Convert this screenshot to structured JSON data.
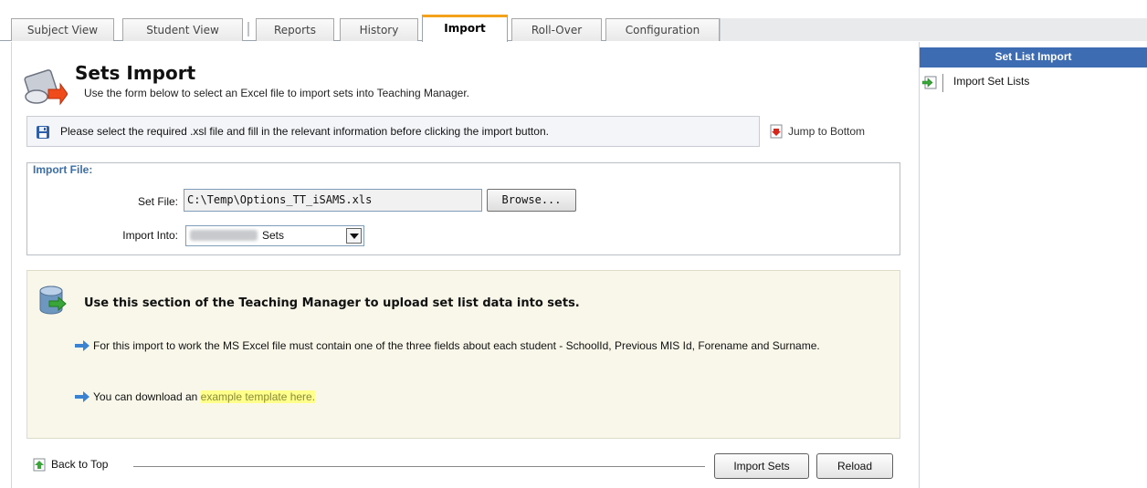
{
  "tabs": [
    {
      "label": "Subject View",
      "active": false
    },
    {
      "label": "Student View",
      "active": false
    },
    {
      "label": "Reports",
      "active": false
    },
    {
      "label": "History",
      "active": false
    },
    {
      "label": "Import",
      "active": true
    },
    {
      "label": "Roll-Over",
      "active": false
    },
    {
      "label": "Configuration",
      "active": false
    }
  ],
  "page": {
    "title": "Sets Import",
    "subtitle": "Use the form below to select an Excel file to import sets into Teaching Manager."
  },
  "notice": {
    "text": "Please select the required .xsl file and fill in the relevant information before clicking the import button.",
    "jump_label": "Jump to Bottom"
  },
  "import_file": {
    "legend": "Import File:",
    "set_file_label": "Set File:",
    "set_file_value": "C:\\Temp\\Options_TT_iSAMS.xls",
    "browse_label": "Browse...",
    "import_into_label": "Import Into:",
    "import_into_value": "Sets"
  },
  "info": {
    "title": "Use this section of the Teaching Manager to upload set list data into sets.",
    "bullet1": "For this import to work the MS Excel file must contain one of the three fields about each student - SchoolId, Previous MIS Id, Forename and Surname.",
    "bullet2_prefix": "You can download an ",
    "bullet2_link": "example template here."
  },
  "footer": {
    "back_to_top": "Back to Top",
    "import_button": "Import Sets",
    "reload_button": "Reload"
  },
  "sidebar": {
    "header": "Set List Import",
    "items": [
      {
        "label": "Import Set Lists"
      }
    ]
  },
  "colors": {
    "active_tab_accent": "#f2a21b",
    "sidebar_header_bg": "#3e6cb3",
    "legend_text": "#3c6ea6",
    "info_bg": "#f9f7ea",
    "link_highlight": "#ffff8c"
  }
}
